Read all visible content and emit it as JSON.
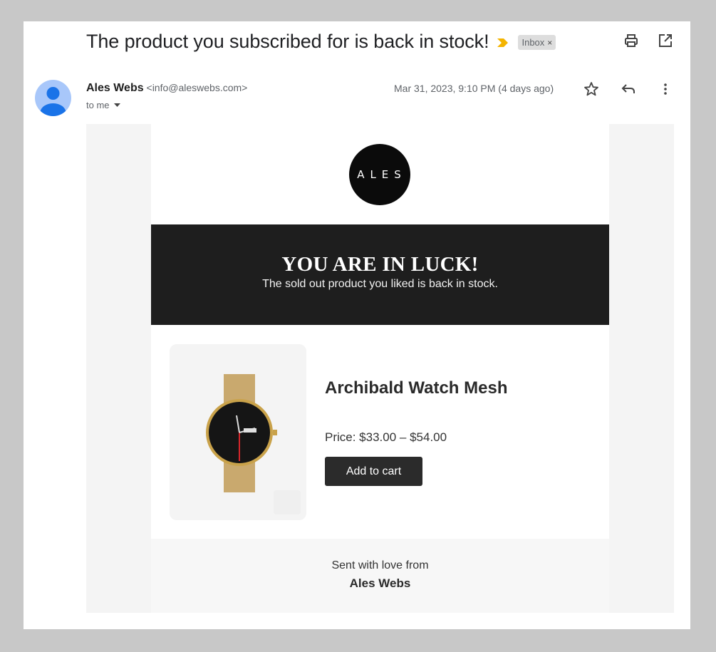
{
  "subject": "The product you subscribed for is back in stock!",
  "inbox_label": "Inbox",
  "inbox_remove": "×",
  "sender": {
    "name": "Ales Webs",
    "email": "<info@aleswebs.com>",
    "to": "to me"
  },
  "date": "Mar 31, 2023, 9:10 PM (4 days ago)",
  "email": {
    "logo_text": "ALES",
    "banner_title": "YOU ARE IN LUCK!",
    "banner_subtitle": "The sold out product you liked is back in stock.",
    "product_name": "Archibald Watch Mesh",
    "price": "Price: $33.00 – $54.00",
    "add_to_cart": "Add to cart",
    "footer_line1": "Sent with love from",
    "footer_line2": "Ales Webs"
  },
  "colors": {
    "importance": "#f4b400",
    "banner": "#1e1e1e",
    "button": "#2b2b2b"
  }
}
